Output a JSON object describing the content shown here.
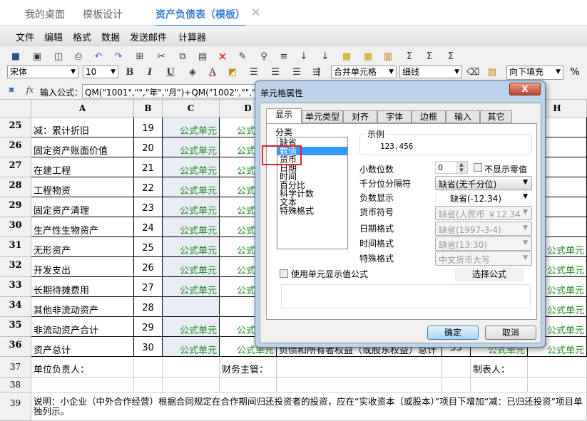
{
  "tabs": [
    {
      "label": "我的桌面"
    },
    {
      "label": "模板设计"
    },
    {
      "label": "资产负债表（模板）"
    }
  ],
  "tab_close": "✕",
  "menu": [
    "文件",
    "编辑",
    "格式",
    "数据",
    "发送邮件",
    "计算器"
  ],
  "toolbar": {
    "font": "宋体",
    "size": "10",
    "merge": "合并单元格",
    "line": "细线",
    "fill": "向下填充",
    "percent": "%",
    "bold": "B",
    "italic": "I",
    "underline": "U",
    "font_color": "A"
  },
  "formula": {
    "fx": "fx",
    "label": "输入公式：",
    "value": "QM(\"1001\",\"\",\"年\",\"月\")+QM(\"1002\",\"\",\"年\",\"月\")+QM"
  },
  "columns": [
    "A",
    "B",
    "C",
    "D",
    "H"
  ],
  "rows": [
    {
      "n": "25",
      "a": "减：累计折旧",
      "b": "19",
      "c": "公式单元",
      "d": "公式单元"
    },
    {
      "n": "26",
      "a": "固定资产账面价值",
      "b": "20",
      "c": "公式单元",
      "d": "公式单元"
    },
    {
      "n": "27",
      "a": "在建工程",
      "b": "21",
      "c": "公式单元",
      "d": "公式单元"
    },
    {
      "n": "28",
      "a": "工程物资",
      "b": "22",
      "c": "公式单元",
      "d": "公式单元"
    },
    {
      "n": "29",
      "a": "固定资产清理",
      "b": "23",
      "c": "公式单元",
      "d": "公式单元"
    },
    {
      "n": "30",
      "a": "生产性生物资产",
      "b": "24",
      "c": "公式单元",
      "d": "公式单元"
    },
    {
      "n": "31",
      "a": "无形资产",
      "b": "25",
      "c": "公式单元",
      "d": "公式单元",
      "h": "公式单元"
    },
    {
      "n": "32",
      "a": "开发支出",
      "b": "26",
      "c": "公式单元",
      "d": "公式单元",
      "h": "公式单元"
    },
    {
      "n": "33",
      "a": "长期待摊费用",
      "b": "27",
      "c": "公式单元",
      "d": "公式单元",
      "h": "公式单元"
    },
    {
      "n": "34",
      "a": "其他非流动资产",
      "b": "28",
      "c": "",
      "d": "",
      "h": "公式单元"
    },
    {
      "n": "35",
      "a": "非流动资产合计",
      "b": "29",
      "c": "公式单元",
      "d": "公式单元",
      "h": "公式单元"
    },
    {
      "n": "36",
      "a": "资产总计",
      "b": "30",
      "c": "公式单元",
      "d": "公式单元",
      "e": "负债和所有者权益（或股东权益）总计",
      "f": "53",
      "g": "公式单元",
      "h": "公式单元"
    }
  ],
  "row37": {
    "n": "37",
    "a": "单位负责人：",
    "d": "财务主管：",
    "g": "制表人："
  },
  "row38": {
    "n": "38"
  },
  "row39": {
    "n": "39",
    "text": "说明：小企业（中外合作经营）根据合同规定在合作期间归还投资者的投资，应在“实收资本（或股本）”项目下增加“减：已归还投资”项目单独列示。"
  },
  "dialog": {
    "title": "单元格属性",
    "close": "X",
    "tabs": [
      "显示",
      "单元类型",
      "对齐",
      "字体",
      "边框",
      "输入",
      "其它"
    ],
    "category_label": "分类",
    "categories": [
      "缺省",
      "数值",
      "货币",
      "日期",
      "时间",
      "百分比",
      "科学计数",
      "文本",
      "特殊格式"
    ],
    "selected_category": "数值",
    "sample_label": "示例",
    "sample_value": "123.456",
    "decimal_label": "小数位数",
    "decimal_value": "0",
    "hide_zero_label": "不显示零值",
    "thousand_label": "千分位分隔符",
    "thousand_value": "缺省(无千分位)",
    "negative_label": "负数显示",
    "negative_value": "缺省(-12.34)",
    "currency_label": "货币符号",
    "currency_value": "缺省(人民币 ￥12.34",
    "date_label": "日期格式",
    "date_value": "缺省(1997-3-4)",
    "time_label": "时间格式",
    "time_value": "缺省(13:30)",
    "special_label": "特殊格式",
    "special_value": "中文货币大写",
    "use_formula_label": "使用单元显示值公式",
    "choose_formula": "选择公式",
    "ok": "确定",
    "cancel": "取消"
  }
}
